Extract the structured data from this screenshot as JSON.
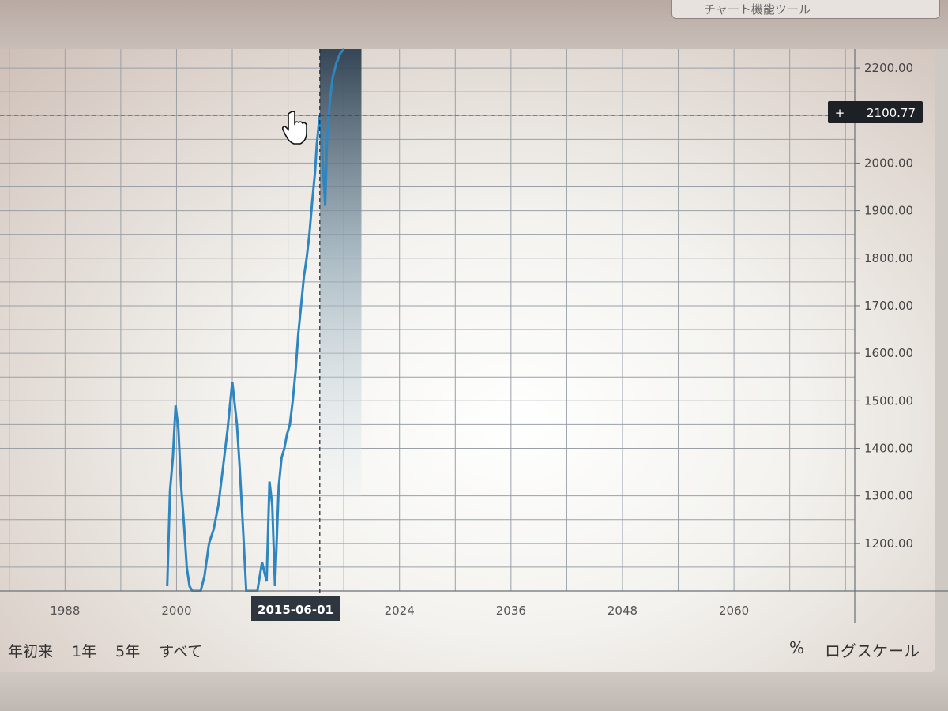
{
  "top_button": {
    "label": "チャート機能ツール"
  },
  "range_buttons": [
    "年初来",
    "1年",
    "5年",
    "すべて"
  ],
  "right_controls": {
    "percent": "%",
    "log_scale": "ログスケール"
  },
  "crosshair": {
    "date": "2015-06-01",
    "x": 2015.42,
    "value": 2100.77,
    "value_label": "2100.77",
    "plus": "+"
  },
  "colors": {
    "line": "#2e86c1",
    "shade_top": "#34495e",
    "shade_bottom": "#dfe9ee",
    "grid": "#9aa0a6"
  },
  "chart_data": {
    "type": "line",
    "x_tick_labels": [
      "1988",
      "2000",
      "2024",
      "2036",
      "2048",
      "2060"
    ],
    "x_tick_values": [
      1988,
      2000,
      2024,
      2036,
      2048,
      2060
    ],
    "y_tick_labels": [
      "1200.00",
      "1300.00",
      "1400.00",
      "1500.00",
      "1600.00",
      "1700.00",
      "1800.00",
      "1900.00",
      "2000.00",
      "2100.00",
      "2200.00"
    ],
    "y_tick_values": [
      1200,
      1300,
      1400,
      1500,
      1600,
      1700,
      1800,
      1900,
      2000,
      2100,
      2200
    ],
    "xlim": [
      1981,
      2073
    ],
    "ylim": [
      1100,
      2240
    ],
    "grid": true,
    "shaded_region": {
      "x_start": 2015.42,
      "x_end": 2019.9
    },
    "series": [
      {
        "x": [
          1999.0,
          1999.3,
          1999.6,
          1999.9,
          2000.2,
          2000.5,
          2000.8,
          2001.1,
          2001.4,
          2001.7,
          2002.0,
          2002.3,
          2002.6,
          2003.0,
          2003.5,
          2004.0,
          2004.5,
          2005.0,
          2005.5,
          2006.0,
          2006.5,
          2006.8,
          2007.1,
          2007.5,
          2007.9,
          2008.3,
          2008.7,
          2009.2,
          2009.7,
          2010.0,
          2010.3,
          2010.6,
          2011.0,
          2011.3,
          2011.6,
          2011.9,
          2012.2,
          2012.5,
          2012.8,
          2013.1,
          2013.4,
          2013.7,
          2014.0,
          2014.3,
          2014.6,
          2014.9,
          2015.1,
          2015.3,
          2015.42,
          2015.6,
          2015.8,
          2016.0,
          2016.2,
          2016.5,
          2016.8,
          2017.2,
          2017.6,
          2018.0
        ],
        "y": [
          1110,
          1310,
          1380,
          1490,
          1440,
          1320,
          1240,
          1150,
          1110,
          1100,
          1100,
          1100,
          1100,
          1130,
          1200,
          1230,
          1280,
          1360,
          1440,
          1540,
          1450,
          1360,
          1250,
          1100,
          1100,
          1100,
          1100,
          1160,
          1120,
          1330,
          1280,
          1110,
          1320,
          1380,
          1400,
          1430,
          1450,
          1500,
          1560,
          1640,
          1700,
          1760,
          1800,
          1850,
          1920,
          1980,
          2040,
          2080,
          2100,
          2060,
          1980,
          1910,
          2050,
          2130,
          2180,
          2210,
          2230,
          2240
        ]
      }
    ]
  }
}
